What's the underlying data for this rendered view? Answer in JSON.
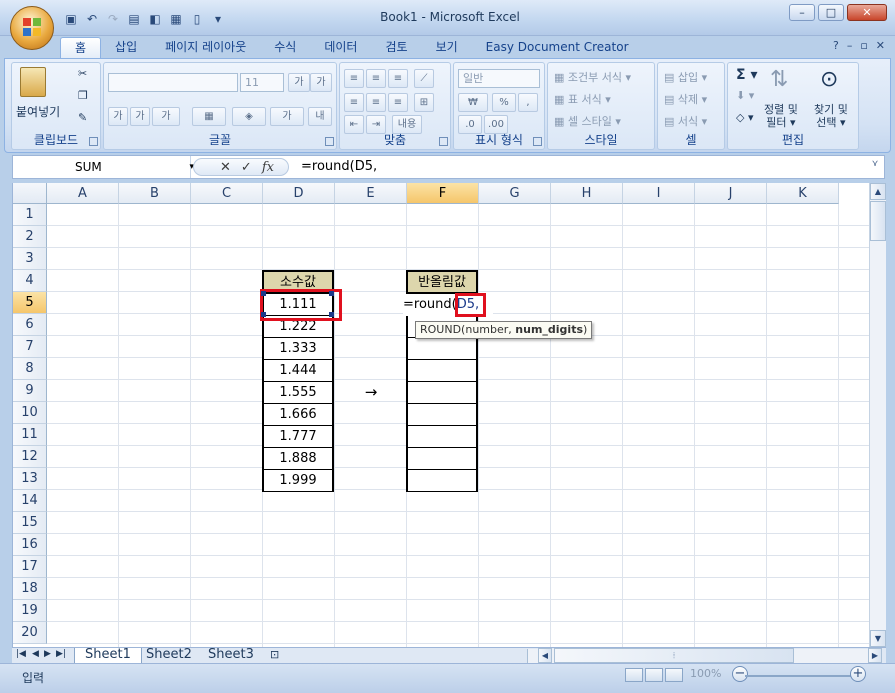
{
  "window": {
    "title": "Book1 - Microsoft Excel"
  },
  "tabs": [
    "홈",
    "삽입",
    "페이지 레이아웃",
    "수식",
    "데이터",
    "검토",
    "보기",
    "Easy Document Creator"
  ],
  "ribbon": {
    "clipboard": {
      "label": "클립보드",
      "paste": "붙여넣기"
    },
    "font": {
      "label": "글꼴",
      "size": "11",
      "bold": "가",
      "italic": "가",
      "underline": "가"
    },
    "align": {
      "label": "맞춤",
      "wrap": "내용"
    },
    "number": {
      "label": "표시 형식",
      "format": "일반",
      "currency": "₩",
      "percent": "%"
    },
    "styles": {
      "label": "스타일",
      "cond": "조건부 서식",
      "table": "표 서식",
      "cell": "셀 스타일"
    },
    "cells": {
      "label": "셀",
      "insert": "삽입",
      "delete": "삭제",
      "format": "서식"
    },
    "edit": {
      "label": "편집",
      "sort": "정렬 및",
      "filter": "필터",
      "find": "찾기 및",
      "select": "선택"
    }
  },
  "formula_bar": {
    "name_box": "SUM",
    "formula": "=round(D5,"
  },
  "columns": [
    "A",
    "B",
    "C",
    "D",
    "E",
    "F",
    "G",
    "H",
    "I",
    "J",
    "K"
  ],
  "rows": [
    "1",
    "2",
    "3",
    "4",
    "5",
    "6",
    "7",
    "8",
    "9",
    "10",
    "11",
    "12",
    "13",
    "14",
    "15",
    "16",
    "17",
    "18",
    "19",
    "20"
  ],
  "sheet": {
    "d_header": "소수값",
    "f_header": "반올림값",
    "d_values": [
      "1.111",
      "1.222",
      "1.333",
      "1.444",
      "1.555",
      "1.666",
      "1.777",
      "1.888",
      "1.999"
    ],
    "arrow": "→",
    "f5_prefix": "=round(",
    "f5_ref": "D5,",
    "tooltip_prefix": "ROUND(number, ",
    "tooltip_bold": "num_digits",
    "tooltip_suffix": ")"
  },
  "sheets": [
    "Sheet1",
    "Sheet2",
    "Sheet3"
  ],
  "status": {
    "mode": "입력",
    "zoom": "100%"
  },
  "colors": {
    "header_fill": "#ddd6ac",
    "highlight": "#e0101e",
    "accent": "#1b3a8a"
  }
}
